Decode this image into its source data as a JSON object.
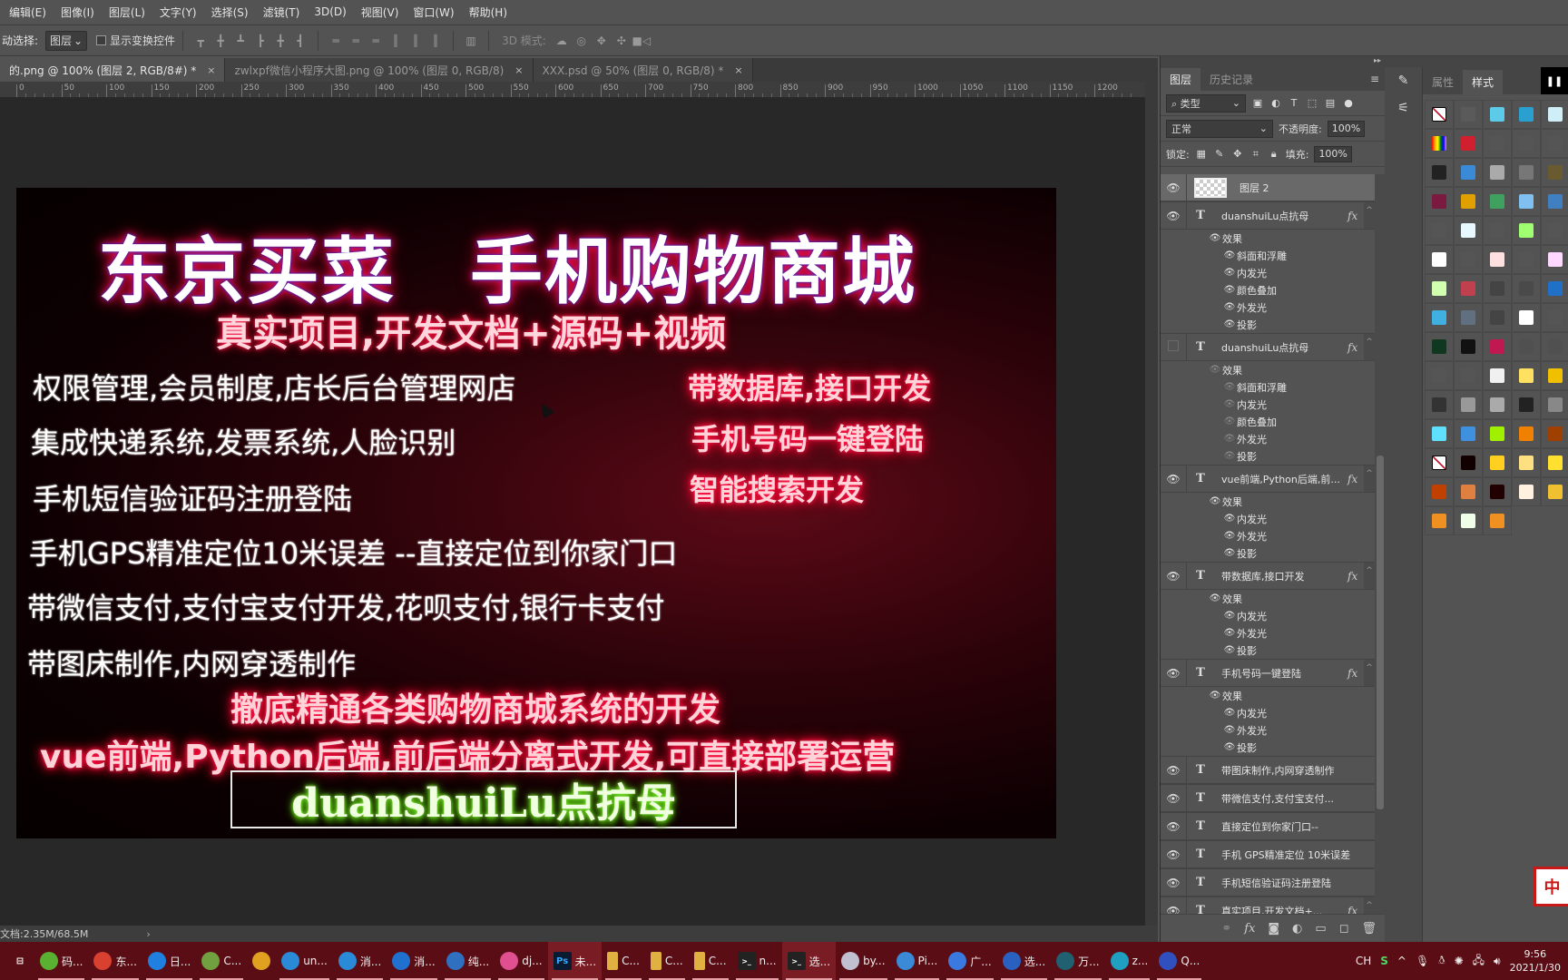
{
  "menubar": {
    "items": [
      "编辑(E)",
      "图像(I)",
      "图层(L)",
      "文字(Y)",
      "选择(S)",
      "滤镜(T)",
      "3D(D)",
      "视图(V)",
      "窗口(W)",
      "帮助(H)"
    ]
  },
  "options": {
    "auto_select_label": "动选择:",
    "auto_select_value": "图层",
    "show_transform_label": "显示变换控件",
    "mode3d_label": "3D 模式:"
  },
  "tabs": [
    {
      "label": "的.png @ 100% (图层 2, RGB/8#) *",
      "active": true
    },
    {
      "label": "zwlxpf微信小程序大图.png @ 100% (图层 0, RGB/8)",
      "active": false
    },
    {
      "label": "XXX.psd @ 50% (图层 0, RGB/8) *",
      "active": false
    }
  ],
  "ruler": {
    "labels": [
      "0",
      "50",
      "100",
      "150",
      "200",
      "250",
      "300",
      "350",
      "400",
      "450",
      "500",
      "550",
      "600",
      "650",
      "700",
      "750",
      "800",
      "850",
      "900",
      "950",
      "1000",
      "1050",
      "1100",
      "1150",
      "1200"
    ]
  },
  "artwork": {
    "title": "东京买菜　手机购物商城",
    "subtitle": "真实项目,开发文档+源码+视频",
    "left_lines": [
      "权限管理,会员制度,店长后台管理网店",
      "集成快递系统,发票系统,人脸识别",
      "手机短信验证码注册登陆",
      "手机GPS精准定位10米误差 --直接定位到你家门口",
      "带微信支付,支付宝支付开发,花呗支付,银行卡支付",
      "带图床制作,内网穿透制作"
    ],
    "right_lines": [
      "带数据库,接口开发",
      "手机号码一键登陆",
      "智能搜索开发"
    ],
    "bottom_line1": "撤底精通各类购物商城系统的开发",
    "bottom_line2": "vue前端,Python后端,前后端分离式开发,可直接部署运营",
    "signature": "duanshuiLu点抗母"
  },
  "status": {
    "doc_size": "文档:2.35M/68.5M",
    "arrow": "›"
  },
  "layers_panel": {
    "tabs": [
      "图层",
      "历史记录"
    ],
    "filter_label": "类型",
    "blend_mode": "正常",
    "opacity_label": "不透明度:",
    "opacity_value": "100%",
    "lock_label": "锁定:",
    "fill_label": "填充:",
    "fill_value": "100%",
    "effects_label": "效果",
    "layers": [
      {
        "name": "图层 2",
        "type": "pixel",
        "visible": true,
        "selected": true,
        "fx": false,
        "effects": []
      },
      {
        "name": "duanshuiLu点抗母",
        "type": "text",
        "visible": true,
        "fx": true,
        "effects": [
          "斜面和浮雕",
          "内发光",
          "颜色叠加",
          "外发光",
          "投影"
        ],
        "effects_dim": false
      },
      {
        "name": "duanshuiLu点抗母",
        "type": "text",
        "visible": false,
        "fx": true,
        "effects": [
          "斜面和浮雕",
          "内发光",
          "颜色叠加",
          "外发光",
          "投影"
        ],
        "effects_dim": true
      },
      {
        "name": "vue前端,Python后端,前...",
        "type": "text",
        "visible": true,
        "fx": true,
        "effects": [
          "内发光",
          "外发光",
          "投影"
        ],
        "effects_dim": false
      },
      {
        "name": "带数据库,接口开发",
        "type": "text",
        "visible": true,
        "fx": true,
        "effects": [
          "内发光",
          "外发光",
          "投影"
        ],
        "effects_dim": false
      },
      {
        "name": "手机号码一键登陆",
        "type": "text",
        "visible": true,
        "fx": true,
        "effects": [
          "内发光",
          "外发光",
          "投影"
        ],
        "effects_dim": false
      },
      {
        "name": "带图床制作,内网穿透制作",
        "type": "text",
        "visible": true,
        "fx": false,
        "effects": []
      },
      {
        "name": "带微信支付,支付宝支付...",
        "type": "text",
        "visible": true,
        "fx": false,
        "effects": []
      },
      {
        "name": "直接定位到你家门口--",
        "type": "text",
        "visible": true,
        "fx": false,
        "effects": []
      },
      {
        "name": "手机 GPS精准定位 10米误差",
        "type": "text",
        "visible": true,
        "fx": false,
        "effects": []
      },
      {
        "name": "手机短信验证码注册登陆",
        "type": "text",
        "visible": true,
        "fx": false,
        "effects": []
      },
      {
        "name": "真实项目,开发文档+...",
        "type": "text",
        "visible": true,
        "fx": true,
        "effects": []
      }
    ]
  },
  "right_panel": {
    "tabs": [
      "属性",
      "样式"
    ],
    "active_tab": "样式",
    "pause_icon": "❚❚",
    "swatch_colors": [
      "none",
      "#5a5a5a",
      "#5ccbe8",
      "#2aa0d0",
      "#cfeef8",
      "#rainbow",
      "#d02030",
      "#555555",
      "#555555",
      "#555555",
      "#222222",
      "#3a8ad8",
      "#aaaaaa",
      "#777777",
      "#6a5a30",
      "#7a1a40",
      "#e0a000",
      "#40a060",
      "#80c0f0",
      "#4080c0",
      "#555555",
      "#e8f8ff",
      "#555555",
      "#a0ff70",
      "#555555",
      "#ffffff",
      "#555555",
      "#ffe0e0",
      "#555555",
      "#ffd8ff",
      "#d0ffb0",
      "#c04050",
      "#444444",
      "#4a4a4a",
      "#2070c8",
      "#40b0e0",
      "#607080",
      "#444444",
      "#ffffff",
      "#555555",
      "#103820",
      "#111111",
      "#c01850",
      "#505050",
      "#505050",
      "#555555",
      "#555555",
      "#f0f0f0",
      "#ffe060",
      "#f0c000",
      "#333333",
      "#999999",
      "#aaaaaa",
      "#222222",
      "#888888",
      "#60e0ff",
      "#4090e0",
      "#a0f000",
      "#f08000",
      "#a04000",
      "none",
      "#100000",
      "#ffd020",
      "#ffe080",
      "#ffe030",
      "#c04000",
      "#e08040",
      "#200000",
      "#fff0e0",
      "#f0c030",
      "#f09020",
      "#f0ffe8",
      "#f09020"
    ],
    "ime_badge": "中"
  },
  "taskbar": {
    "items": [
      {
        "label": "",
        "icon": "task-view-icon",
        "color": "#5a0d14"
      },
      {
        "label": "码...",
        "icon": "ie-green-icon",
        "color": "#5ab030"
      },
      {
        "label": "东...",
        "icon": "chrome-icon",
        "color": "#d84030"
      },
      {
        "label": "日...",
        "icon": "q-browser-icon",
        "color": "#2080e0"
      },
      {
        "label": "C...",
        "icon": "notepad-icon",
        "color": "#70a040"
      },
      {
        "label": "",
        "icon": "app-colorful-icon",
        "color": "#e0a020"
      },
      {
        "label": "un...",
        "icon": "ie-icon",
        "color": "#2a8ad8"
      },
      {
        "label": "消...",
        "icon": "ie-icon",
        "color": "#2a8ad8"
      },
      {
        "label": "消...",
        "icon": "feather-icon",
        "color": "#2070d0"
      },
      {
        "label": "纯...",
        "icon": "sogou-icon",
        "color": "#3070c0"
      },
      {
        "label": "dj...",
        "icon": "photos-icon",
        "color": "#e05090"
      },
      {
        "label": "未...",
        "icon": "photoshop-icon",
        "color": "#0a1a30",
        "active": true
      },
      {
        "label": "C...",
        "icon": "folder-icon",
        "color": "#e0b040"
      },
      {
        "label": "C...",
        "icon": "folder-icon",
        "color": "#e0b040"
      },
      {
        "label": "C...",
        "icon": "folder-icon",
        "color": "#e0b040"
      },
      {
        "label": "n...",
        "icon": "cmd-icon",
        "color": "#222222"
      },
      {
        "label": "选...",
        "icon": "cmd-icon",
        "color": "#222222",
        "active": true
      },
      {
        "label": "by...",
        "icon": "avatar-icon",
        "color": "#c0c0d0"
      },
      {
        "label": "Pi...",
        "icon": "pycharm-icon",
        "color": "#3a8ad8"
      },
      {
        "label": "广...",
        "icon": "wps-icon",
        "color": "#3a7ae0"
      },
      {
        "label": "选...",
        "icon": "powershell-icon",
        "color": "#2a60c0"
      },
      {
        "label": "万...",
        "icon": "installer-icon",
        "color": "#206070"
      },
      {
        "label": "z...",
        "icon": "webstorm-icon",
        "color": "#20a0c0"
      },
      {
        "label": "Q...",
        "icon": "media-icon",
        "color": "#3050c0"
      }
    ],
    "tray": {
      "lang": "CH",
      "time": "9:56",
      "date": "2021/1/30"
    }
  }
}
